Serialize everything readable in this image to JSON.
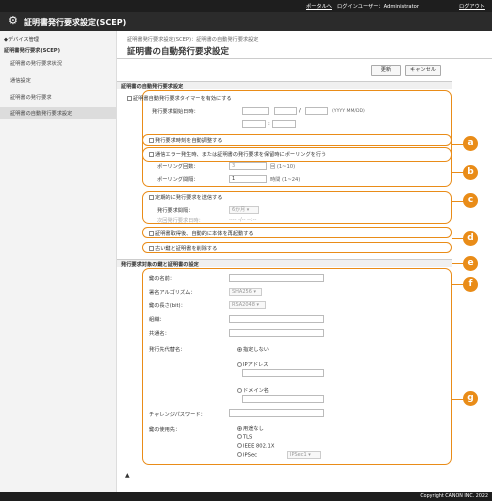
{
  "topbar": {
    "portal": "ポータルへ",
    "login_user": "ログインユーザー：Administrator",
    "logout": "ログアウト"
  },
  "app": {
    "title": "証明書発行要求設定(SCEP)"
  },
  "sidebar": {
    "back": "◆デバイス管理",
    "group": "証明書発行要求(SCEP)",
    "items": [
      "証明書の発行要求状況",
      "通信設定",
      "証明書の発行要求",
      "証明書の自動発行要求設定"
    ]
  },
  "breadcrumb": "証明書発行要求設定(SCEP)：証明書の自動発行要求設定",
  "page_title": "証明書の自動発行要求設定",
  "buttons": {
    "update": "更新",
    "cancel": "キャンセル"
  },
  "section1": {
    "title": "証明書の自動発行要求設定",
    "timer_enable": "証明書自動発行要求タイマーを有効にする",
    "start_label": "発行要求開始日時：",
    "date_hint": "(YYYY MM/DD)",
    "date_sep": "/",
    "time_sep": ":",
    "check_expiry": "発行要求時刻を自動調整する",
    "polling_enable": "通信エラー発生時、または証明書の発行要求を保留時にポーリングを行う",
    "polling_count_label": "ポーリング回数：",
    "polling_count_value": "3",
    "polling_count_hint": "回 (1~10)",
    "polling_interval_label": "ポーリング間隔：",
    "polling_interval_value": "1",
    "polling_interval_hint": "時間 (1~24)",
    "periodic_enable": "定期的に発行要求を送信する",
    "interval_label": "発行要求間隔：",
    "interval_value": "6か月",
    "next_label": "次回発行要求日時：",
    "next_value": "---- -/-- --:--",
    "restart": "証明書取得後、自動的に本体を再起動する",
    "delete_old": "古い鍵と証明書を削除する"
  },
  "section2": {
    "title": "発行要求対象の鍵と証明書の設定",
    "key_name_label": "鍵の名前：",
    "sig_alg_label": "署名アルゴリズム：",
    "sig_alg_value": "SHA256",
    "key_len_label": "鍵の長さ(bit)：",
    "key_len_value": "RSA2048",
    "org_label": "組織：",
    "cn_label": "共通名：",
    "san_label": "発行先代替名：",
    "san_opts": [
      "指定しない",
      "IPアドレス",
      "ドメイン名"
    ],
    "challenge_label": "チャレンジパスワード：",
    "key_usage_label": "鍵の使用先：",
    "usage_opts": [
      "用途なし",
      "TLS",
      "IEEE 802.1X",
      "IPSec"
    ],
    "ipsec_value": "IPSec1"
  },
  "callouts": [
    "a",
    "b",
    "c",
    "d",
    "e",
    "f",
    "g"
  ],
  "footer": "Copyright CANON INC. 2022",
  "colors": {
    "accent": "#e98c18",
    "topbar": "#1e1e1e"
  }
}
